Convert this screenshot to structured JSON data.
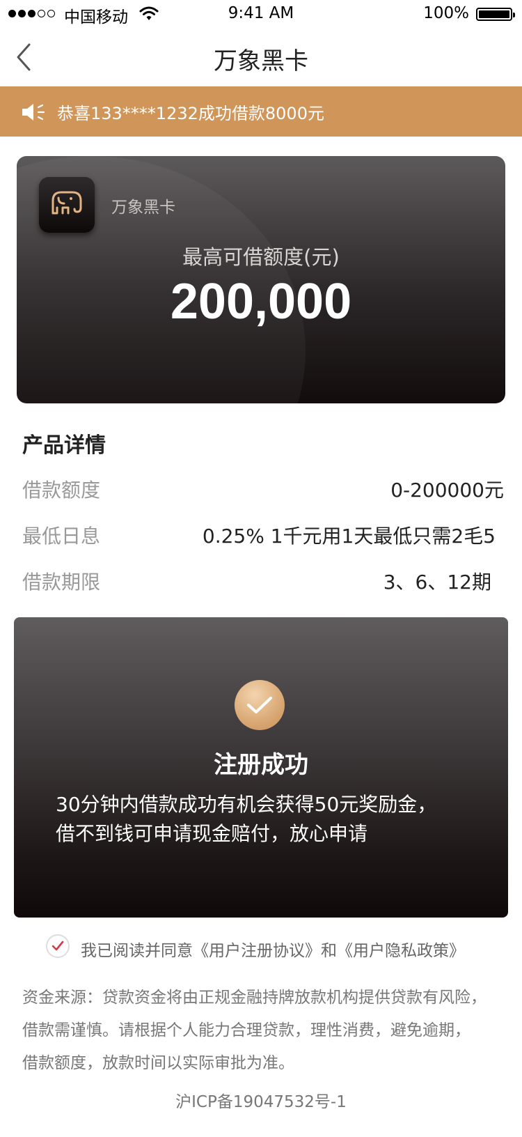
{
  "status_bar": {
    "carrier": "中国移动",
    "time": "9:41 AM",
    "battery": "100%",
    "signal_strength": 3,
    "signal_total": 5
  },
  "nav": {
    "title": "万象黑卡",
    "back_icon": "chevron-left-icon"
  },
  "notice": {
    "icon": "speaker-icon",
    "text": "恭喜133****1232成功借款8000元",
    "background": "#cf9559"
  },
  "card": {
    "app_name": "万象黑卡",
    "logo_icon": "elephant-icon",
    "limit_label": "最高可借额度(元)",
    "limit_value": "200,000"
  },
  "product": {
    "title": "产品详情",
    "rows": [
      {
        "label": "借款额度",
        "value": "0-200000元"
      },
      {
        "label": "最低日息",
        "value": "0.25% 1千元用1天最低只需2毛5"
      },
      {
        "label": "借款期限",
        "value": "3、6、12期"
      }
    ]
  },
  "success": {
    "icon": "checkmark-icon",
    "title": "注册成功",
    "lines": [
      "30分钟内借款成功有机会获得50元奖励金，",
      "借不到钱可申请现金赔付，放心申请"
    ]
  },
  "agreement": {
    "checked": true,
    "text": "我已阅读并同意《用户注册协议》和《用户隐私政策》"
  },
  "disclaimer": {
    "lines": [
      "资金来源：贷款资金将由正规金融持牌放款机构提供贷款有风险，",
      "借款需谨慎。请根据个人能力合理贷款，理性消费，避免逾期，",
      "借款额度，放款时间以实际审批为准。"
    ]
  },
  "icp": "沪ICP备19047532号-1",
  "colors": {
    "accent": "#cf9559",
    "check_red": "#e0344a",
    "card_dark": "#120c0d"
  }
}
